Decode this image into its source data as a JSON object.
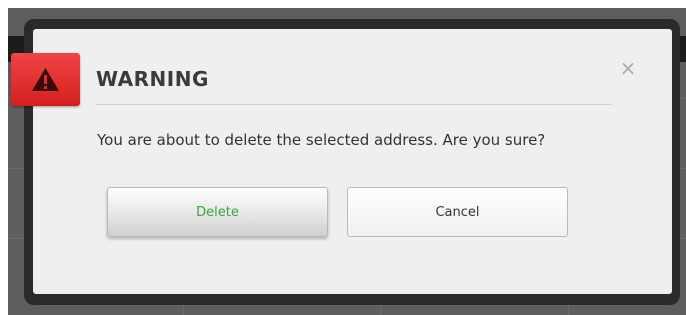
{
  "dialog": {
    "title": "WARNING",
    "message": "You are about to delete the selected address. Are you sure?",
    "close_glyph": "×",
    "icon": "warning-triangle-icon",
    "accent_color": "#e02b2b"
  },
  "buttons": {
    "delete_label": "Delete",
    "cancel_label": "Cancel",
    "delete_color": "#3aa53a"
  }
}
